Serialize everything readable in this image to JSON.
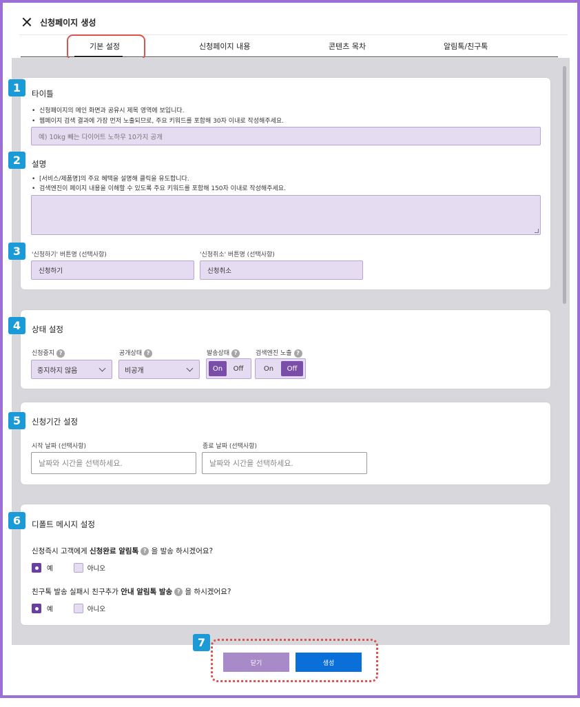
{
  "header": {
    "title": "신청페이지 생성"
  },
  "tabs": [
    {
      "label": "기본 설정"
    },
    {
      "label": "신청페이지 내용"
    },
    {
      "label": "콘텐츠 목차"
    },
    {
      "label": "알림톡/친구톡"
    }
  ],
  "badges": [
    "1",
    "2",
    "3",
    "4",
    "5",
    "6",
    "7"
  ],
  "title_section": {
    "heading": "타이틀",
    "bullets": [
      "신청페이지의 메인 화면과 공유시 제목 영역에 보입니다.",
      "웹페이지 검색 결과에 가장 먼저 노출되므로, 주요 키워드를 포함해 30자 이내로 작성해주세요."
    ],
    "placeholder": "예) 10kg 빼는 다이어트 노하우 10가지 공개"
  },
  "description_section": {
    "heading": "설명",
    "bullets": [
      "[서비스/제품명]의 주요 혜택을 설명해 클릭을 유도합니다.",
      "검색엔진이 페이지 내용을 이해할 수 있도록 주요 키워드를 포함해 150자 이내로 작성해주세요."
    ]
  },
  "button_names": {
    "apply_label": "'신청하기' 버튼명 (선택사항)",
    "apply_value": "신청하기",
    "cancel_label": "'신청취소' 버튼명 (선택사항)",
    "cancel_value": "신청취소"
  },
  "status_section": {
    "heading": "상태 설정",
    "stop_label": "신청중지",
    "stop_value": "중지하지 않음",
    "public_label": "공개상태",
    "public_value": "비공개",
    "send_label": "발송상태",
    "send_on": "On",
    "send_off": "Off",
    "search_label": "검색엔진 노출",
    "search_on": "On",
    "search_off": "Off",
    "help": "?"
  },
  "period_section": {
    "heading": "신청기간 설정",
    "start_label": "시작 날짜 (선택사항)",
    "start_placeholder": "날짜와 시간을 선택하세요.",
    "end_label": "종료 날짜 (선택사항)",
    "end_placeholder": "날짜와 시간을 선택하세요."
  },
  "default_msg_section": {
    "heading": "디폴트 메시지 설정",
    "q1_pre": "신청즉시 고객에게 ",
    "q1_bold": "신청완료 알림톡",
    "q1_post": " 을 발송 하시겠어요?",
    "q2_pre": "친구톡 발송 실패시 친구추가 ",
    "q2_bold": "안내 알림톡 발송",
    "q2_post": " 을 하시겠어요?",
    "yes": "예",
    "no": "아니오"
  },
  "footer": {
    "close_label": "닫기",
    "create_label": "생성"
  }
}
